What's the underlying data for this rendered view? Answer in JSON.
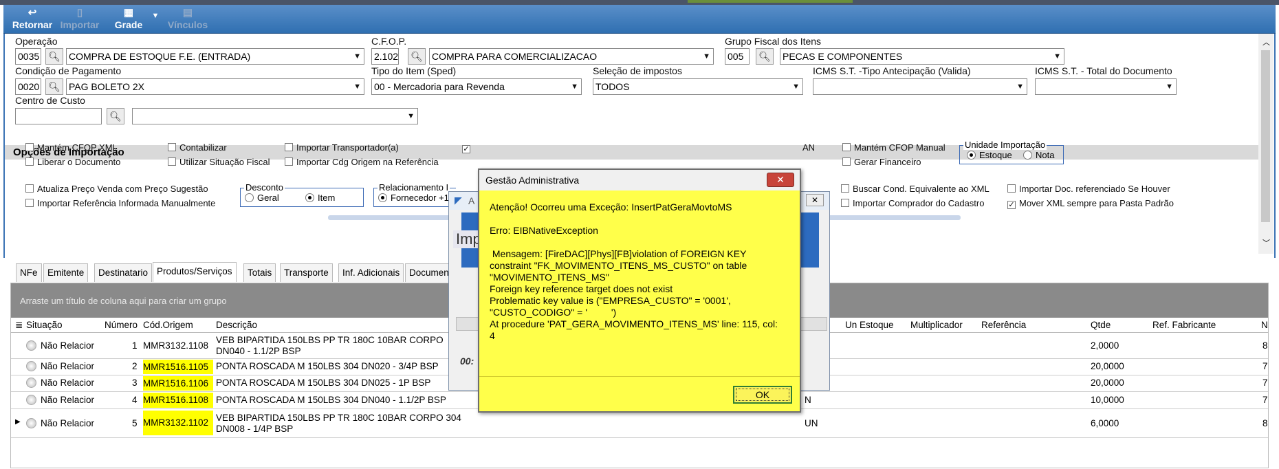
{
  "toolbar": {
    "retornar": "Retornar",
    "importar": "Importar",
    "grade": "Grade",
    "vinculos": "Vínculos"
  },
  "form": {
    "operacao_label": "Operação",
    "operacao_code": "0035",
    "operacao_value": "COMPRA DE ESTOQUE F.E. (ENTRADA)",
    "cfop_label": "C.F.O.P.",
    "cfop_code": "2.102",
    "cfop_value": "COMPRA PARA COMERCIALIZACAO",
    "grupo_label": "Grupo Fiscal dos Itens",
    "grupo_code": "005",
    "grupo_value": "PECAS E COMPONENTES",
    "condicao_label": "Condição de Pagamento",
    "condicao_code": "0020",
    "condicao_value": "PAG BOLETO 2X",
    "tipo_label": "Tipo do Item (Sped)",
    "tipo_value": "00 - Mercadoria para Revenda",
    "selecao_label": "Seleção de impostos",
    "selecao_value": "TODOS",
    "icms_ant_label": "ICMS S.T. -Tipo Antecipação (Valida)",
    "icms_total_label": "ICMS S.T. - Total do Documento",
    "centro_label": "Centro de Custo"
  },
  "opcoes": {
    "title": "Opções de Importação",
    "mantem_cfop_xml": "Mantém CFOP XML",
    "liberar_documento": "Liberar o Documento",
    "contabilizar": "Contabilizar",
    "utilizar_situacao": "Utilizar Situação Fiscal",
    "importar_transportador": "Importar Transportador(a)",
    "importar_cdg_origem": "Importar Cdg Origem na Referência",
    "an_fragment": "AN",
    "mantem_cfop_manual": "Mantém CFOP Manual",
    "gerar_financeiro": "Gerar Financeiro",
    "unidade_title": "Unidade Importação",
    "unidade_estoque": "Estoque",
    "unidade_nota": "Nota",
    "atualiza_preco": "Atualiza Preço Venda com Preço Sugestão",
    "importar_referencia": "Importar Referência Informada Manualmente",
    "desconto_title": "Desconto",
    "desconto_geral": "Geral",
    "desconto_item": "Item",
    "relacionamento_title": "Relacionamento I",
    "relacionamento_opt": "Fornecedor +1",
    "buscar_cond": "Buscar Cond. Equivalente ao XML",
    "importar_comprador": "Importar Comprador do Cadastro",
    "importar_doc_ref": "Importar Doc. referenciado Se Houver",
    "mover_xml": "Mover XML sempre para Pasta Padrão"
  },
  "tabs": [
    "NFe",
    "Emitente",
    "Destinatario",
    "Produtos/Serviços",
    "Totais",
    "Transporte",
    "Inf. Adicionais",
    "Documen"
  ],
  "grid": {
    "group_hint": "Arraste um título de coluna aqui para criar um grupo",
    "headers": {
      "situacao": "Situação",
      "numero": "Número",
      "cod_origem": "Cód.Origem",
      "descricao": "Descrição",
      "un_estoque": "Un Estoque",
      "multiplicador": "Multiplicador",
      "referencia": "Referência",
      "qtde": "Qtde",
      "ref_fabricante": "Ref. Fabricante",
      "n": "N"
    },
    "rows": [
      {
        "situacao": "Não Relacior",
        "numero": "1",
        "cod": "MMR3132.1108",
        "desc1": "VEB BIPARTIDA 150LBS PP TR 180C 10BAR CORPO",
        "desc2": "DN040 - 1.1/2P BSP",
        "un": "",
        "qtde": "2,0000",
        "last": "8"
      },
      {
        "situacao": "Não Relacior",
        "numero": "2",
        "cod": "MMR1516.1105",
        "desc1": "PONTA ROSCADA M 150LBS 304 DN020 - 3/4P BSP",
        "desc2": "",
        "un": "",
        "qtde": "20,0000",
        "last": "7"
      },
      {
        "situacao": "Não Relacior",
        "numero": "3",
        "cod": "MMR1516.1106",
        "desc1": "PONTA ROSCADA M 150LBS 304 DN025 - 1P BSP",
        "desc2": "",
        "un": "",
        "qtde": "20,0000",
        "last": "7"
      },
      {
        "situacao": "Não Relacior",
        "numero": "4",
        "cod": "MMR1516.1108",
        "desc1": "PONTA ROSCADA M 150LBS 304 DN040 - 1.1/2P BSP",
        "desc2": "",
        "un": "N",
        "qtde": "10,0000",
        "last": "7"
      },
      {
        "situacao": "Não Relacior",
        "numero": "5",
        "cod": "MMR3132.1102",
        "desc1": "VEB BIPARTIDA 150LBS PP TR 180C 10BAR CORPO 304",
        "desc2": "DN008 - 1/4P BSP",
        "un": "UN",
        "qtde": "6,0000",
        "last": "8"
      }
    ]
  },
  "bgwindow": {
    "title_fragment": "A",
    "heading_fragment": "Imp",
    "time_fragment": "00:"
  },
  "dialog": {
    "title": "Gestão Administrativa",
    "close": "✕",
    "message": "Atenção! Ocorreu uma Exceção: InsertPatGeraMovtoMS\n\nErro: EIBNativeException\n\n Mensagem: [FireDAC][Phys][FB]violation of FOREIGN KEY\nconstraint \"FK_MOVIMENTO_ITENS_MS_CUSTO\" on table\n\"MOVIMENTO_ITENS_MS\"\nForeign key reference target does not exist\nProblematic key value is (\"EMPRESA_CUSTO\" = '0001',\n\"CUSTO_CODIGO\" = '         ')\nAt procedure 'PAT_GERA_MOVIMENTO_ITENS_MS' line: 115, col:\n4",
    "ok": "OK"
  }
}
